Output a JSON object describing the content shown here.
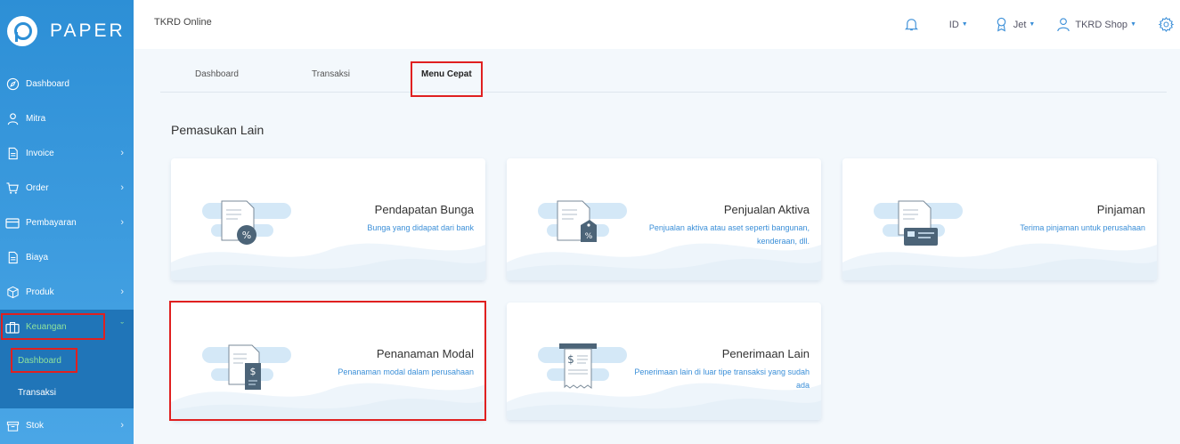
{
  "app": {
    "logo_text": "PAPER",
    "title": "TKRD Online"
  },
  "topbar": {
    "language": "ID",
    "user": "Jet",
    "shop": "TKRD Shop"
  },
  "sidebar": {
    "items": [
      {
        "label": "Dashboard",
        "icon": "compass-icon"
      },
      {
        "label": "Mitra",
        "icon": "user-icon"
      },
      {
        "label": "Invoice",
        "icon": "document-icon"
      },
      {
        "label": "Order",
        "icon": "cart-icon"
      },
      {
        "label": "Pembayaran",
        "icon": "card-icon"
      },
      {
        "label": "Biaya",
        "icon": "document-icon"
      },
      {
        "label": "Produk",
        "icon": "box-icon"
      },
      {
        "label": "Keuangan",
        "icon": "briefcase-icon"
      },
      {
        "label": "Stok",
        "icon": "archive-icon"
      }
    ],
    "sub_items": [
      {
        "label": "Dashboard"
      },
      {
        "label": "Transaksi"
      }
    ]
  },
  "tabs": [
    {
      "label": "Dashboard"
    },
    {
      "label": "Transaksi"
    },
    {
      "label": "Menu Cepat"
    }
  ],
  "section_title": "Pemasukan Lain",
  "cards": [
    {
      "title": "Pendapatan Bunga",
      "desc": "Bunga yang didapat dari bank",
      "icon": "document-percent-icon"
    },
    {
      "title": "Penjualan Aktiva",
      "desc": "Penjualan aktiva atau aset seperti bangunan, kenderaan, dll.",
      "icon": "document-tag-icon"
    },
    {
      "title": "Pinjaman",
      "desc": "Terima pinjaman untuk perusahaan",
      "icon": "document-card-icon"
    },
    {
      "title": "Penanaman Modal",
      "desc": "Penanaman modal dalam perusahaan",
      "icon": "document-dollar-icon"
    },
    {
      "title": "Penerimaan Lain",
      "desc": "Penerimaan lain di luar tipe transaksi yang sudah ada",
      "icon": "receipt-dollar-icon"
    }
  ],
  "colors": {
    "accent": "#3b8fd8",
    "sidebar": "#2d8fd6",
    "active_text": "#8fe39c",
    "highlight": "#e02020"
  }
}
